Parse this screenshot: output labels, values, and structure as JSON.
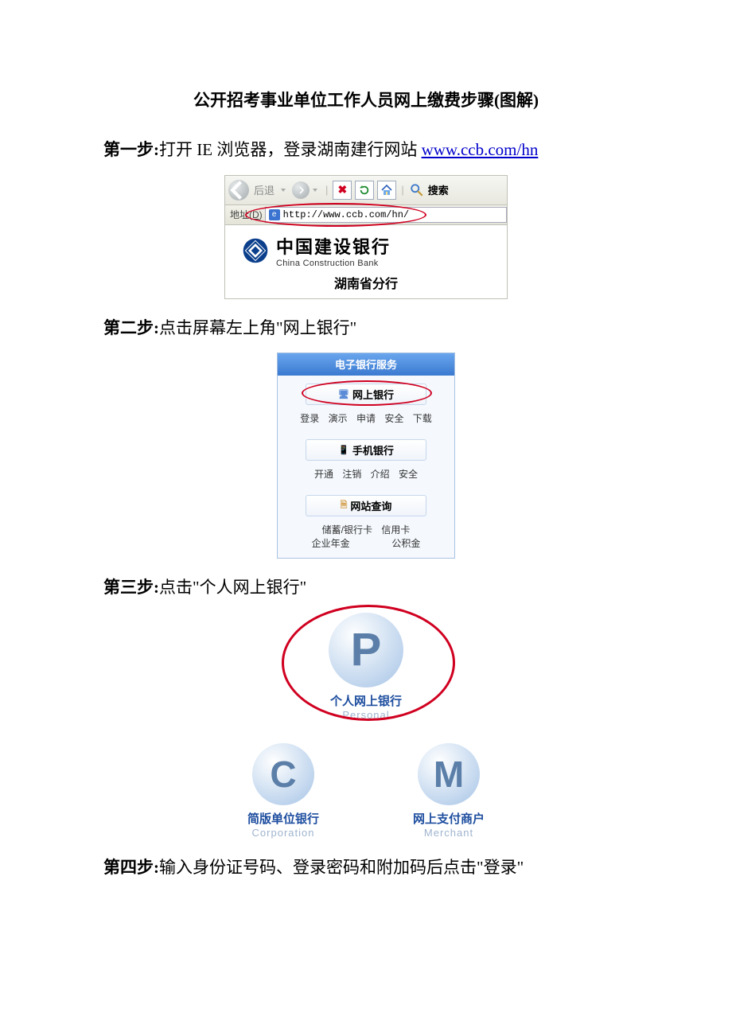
{
  "title": "公开招考事业单位工作人员网上缴费步骤(图解)",
  "step1": {
    "label": "第一步:",
    "text_a": "打开 IE 浏览器，登录湖南建行网站 ",
    "link": "www.ccb.com/hn"
  },
  "fig1": {
    "back": "后退",
    "search": "搜索",
    "addr_label": "地址(D)",
    "url": "http://www.ccb.com/hn/",
    "bank_cn": "中国建设银行",
    "bank_en": "China Construction Bank",
    "branch": "湖南省分行"
  },
  "step2": {
    "label": "第二步:",
    "text_a": "点击屏幕左上角\"",
    "target": "网上银行",
    "text_b": "\""
  },
  "fig2": {
    "header": "电子银行服务",
    "btn1": "网上银行",
    "row1": {
      "a": "登录",
      "b": "演示",
      "c": "申请",
      "d": "安全",
      "e": "下载"
    },
    "btn2": "手机银行",
    "row2": {
      "a": "开通",
      "b": "注销",
      "c": "介绍",
      "d": "安全"
    },
    "btn3": "网站查询",
    "row3": {
      "a": "储蓄/银行卡",
      "b": "信用卡",
      "c": "企业年金",
      "d": "公积金"
    }
  },
  "step3": {
    "label": "第三步:",
    "text_a": "点击\"",
    "target": "个人网上银行",
    "text_b": "\""
  },
  "fig3": {
    "p_letter": "P",
    "p_cn": "个人网上银行",
    "p_en": "Personal",
    "c_letter": "C",
    "c_cn": "简版单位银行",
    "c_en": "Corporation",
    "m_letter": "M",
    "m_cn": "网上支付商户",
    "m_en": "Merchant"
  },
  "step4": {
    "label": "第四步:",
    "text_a": "输入身份证号码、登录密码和附加码后点击\"",
    "target": "登录",
    "text_b": "\""
  }
}
